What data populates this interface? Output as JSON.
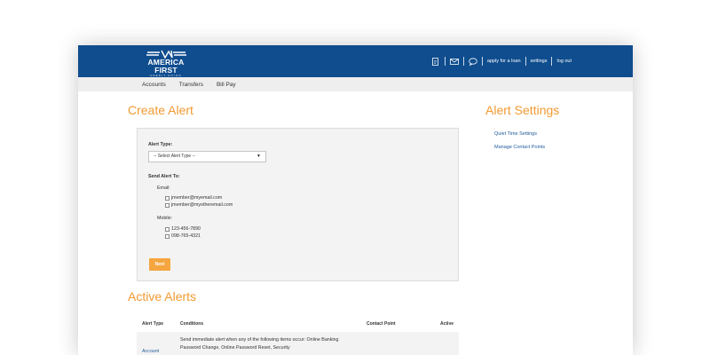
{
  "logo": {
    "brand": "AMERICA FIRST",
    "sub": "CREDIT UNION"
  },
  "topnav": {
    "icons": [
      "document-icon",
      "mail-icon",
      "chat-icon"
    ],
    "links": [
      "apply for a loan",
      "settings",
      "log out"
    ]
  },
  "subnav": {
    "items": [
      "Accounts",
      "Transfers",
      "Bill Pay"
    ]
  },
  "create_alert": {
    "title": "Create Alert",
    "alert_type_label": "Alert Type:",
    "select_value": "-- Select Alert Type --",
    "send_to_label": "Send Alert To:",
    "email_label": "Email:",
    "emails": [
      "jmember@myemail.com",
      "jmember@myotheremail.com"
    ],
    "mobile_label": "Mobile:",
    "mobiles": [
      "123-456-7890",
      "098-765-4321"
    ],
    "next_label": "Next"
  },
  "alert_settings": {
    "title": "Alert Settings",
    "links": [
      "Quiet Time Settings",
      "Manage Contact Points"
    ]
  },
  "active_alerts": {
    "title": "Active Alerts",
    "columns": [
      "Alert Type",
      "Conditions",
      "Contact Point",
      "Active"
    ],
    "rows": [
      {
        "type": "Account",
        "conditions": "Send immediate alert when any of the following items occur: Online Banking Password Change, Online Password Reset, Security"
      }
    ]
  },
  "colors": {
    "header": "#0f4d8e",
    "accent": "#f39a32",
    "link": "#1f5b9b"
  }
}
